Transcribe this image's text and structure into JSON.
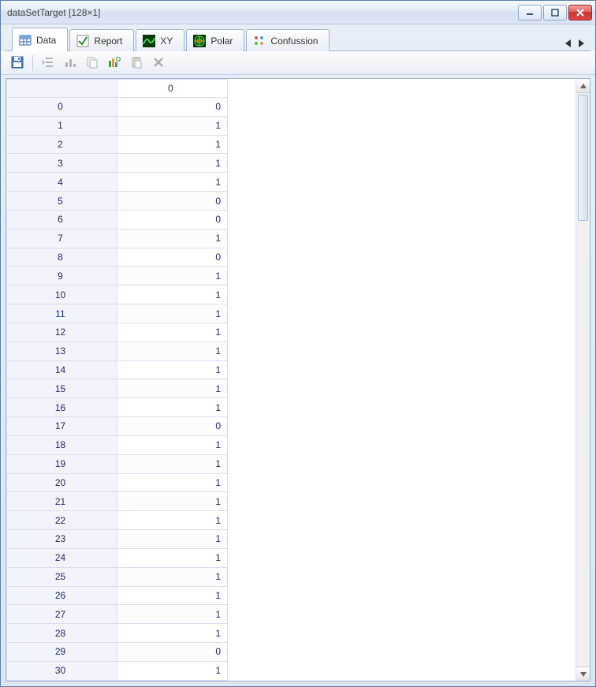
{
  "window": {
    "title": "dataSetTarget [128×1]"
  },
  "tabs": [
    {
      "label": "Data",
      "icon": "table-icon",
      "active": true
    },
    {
      "label": "Report",
      "icon": "check-icon",
      "active": false
    },
    {
      "label": "XY",
      "icon": "xy-icon",
      "active": false
    },
    {
      "label": "Polar",
      "icon": "polar-icon",
      "active": false
    },
    {
      "label": "Confussion",
      "icon": "confusion-icon",
      "active": false
    }
  ],
  "toolbar": {
    "items": [
      {
        "name": "save-icon",
        "disabled": false
      },
      {
        "name": "sep"
      },
      {
        "name": "outdent-icon",
        "disabled": true
      },
      {
        "name": "bars-icon",
        "disabled": true
      },
      {
        "name": "copy-icon",
        "disabled": true
      },
      {
        "name": "chart-add-icon",
        "disabled": false
      },
      {
        "name": "paste-icon",
        "disabled": true
      },
      {
        "name": "delete-icon",
        "disabled": true
      }
    ]
  },
  "grid": {
    "columnHeaders": [
      "0"
    ],
    "rows": [
      {
        "index": "0",
        "values": [
          "0"
        ]
      },
      {
        "index": "1",
        "values": [
          "1"
        ]
      },
      {
        "index": "2",
        "values": [
          "1"
        ]
      },
      {
        "index": "3",
        "values": [
          "1"
        ]
      },
      {
        "index": "4",
        "values": [
          "1"
        ]
      },
      {
        "index": "5",
        "values": [
          "0"
        ]
      },
      {
        "index": "6",
        "values": [
          "0"
        ]
      },
      {
        "index": "7",
        "values": [
          "1"
        ]
      },
      {
        "index": "8",
        "values": [
          "0"
        ]
      },
      {
        "index": "9",
        "values": [
          "1"
        ]
      },
      {
        "index": "10",
        "values": [
          "1"
        ]
      },
      {
        "index": "11",
        "values": [
          "1"
        ]
      },
      {
        "index": "12",
        "values": [
          "1"
        ]
      },
      {
        "index": "13",
        "values": [
          "1"
        ]
      },
      {
        "index": "14",
        "values": [
          "1"
        ]
      },
      {
        "index": "15",
        "values": [
          "1"
        ]
      },
      {
        "index": "16",
        "values": [
          "1"
        ]
      },
      {
        "index": "17",
        "values": [
          "0"
        ]
      },
      {
        "index": "18",
        "values": [
          "1"
        ]
      },
      {
        "index": "19",
        "values": [
          "1"
        ]
      },
      {
        "index": "20",
        "values": [
          "1"
        ]
      },
      {
        "index": "21",
        "values": [
          "1"
        ]
      },
      {
        "index": "22",
        "values": [
          "1"
        ]
      },
      {
        "index": "23",
        "values": [
          "1"
        ]
      },
      {
        "index": "24",
        "values": [
          "1"
        ]
      },
      {
        "index": "25",
        "values": [
          "1"
        ]
      },
      {
        "index": "26",
        "values": [
          "1"
        ]
      },
      {
        "index": "27",
        "values": [
          "1"
        ]
      },
      {
        "index": "28",
        "values": [
          "1"
        ]
      },
      {
        "index": "29",
        "values": [
          "0"
        ]
      },
      {
        "index": "30",
        "values": [
          "1"
        ]
      }
    ]
  }
}
